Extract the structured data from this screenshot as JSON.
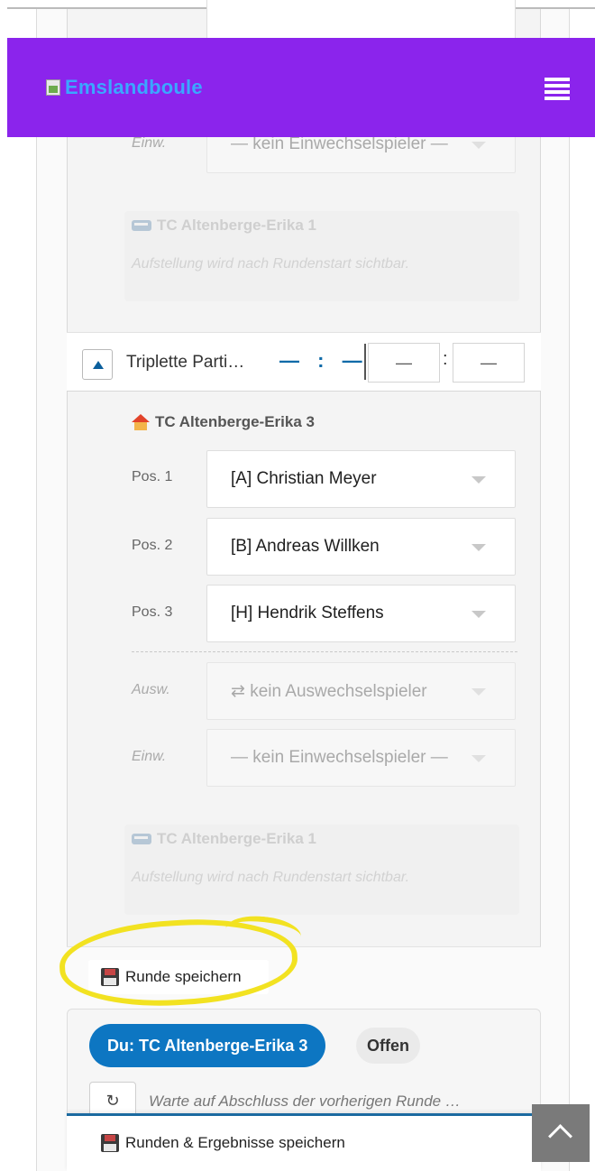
{
  "app": {
    "brand": "Emslandboule"
  },
  "top_partial": {
    "sub_in_label": "Einw.",
    "sub_in_value": "— kein Einwechselspieler —"
  },
  "opponent_top": {
    "name": "TC Altenberge-Erika 1",
    "notice": "Aufstellung wird nach Rundenstart sichtbar."
  },
  "match": {
    "name": "Triplette Parti…",
    "score_left": "—",
    "score_colon": ":",
    "score_right": "—",
    "input_left": "—",
    "input_colon": ":",
    "input_right": "—"
  },
  "team": {
    "name": "TC Altenberge-Erika 3",
    "positions": [
      {
        "label": "Pos. 1",
        "player": "[A] Christian Meyer"
      },
      {
        "label": "Pos. 2",
        "player": "[B] Andreas Willken"
      },
      {
        "label": "Pos. 3",
        "player": "[H] Hendrik Steffens"
      }
    ],
    "sub_out_label": "Ausw.",
    "sub_out_value": "⇄ kein Auswechselspieler",
    "sub_in_label": "Einw.",
    "sub_in_value": "— kein Einwechselspieler —"
  },
  "opponent_bottom": {
    "name": "TC Altenberge-Erika 1",
    "notice": "Aufstellung wird nach Rundenstart sichtbar."
  },
  "save_round_label": "Runde speichern",
  "status": {
    "team_label": "Du: TC Altenberge-Erika 3",
    "state": "Offen",
    "refresh_glyph": "↻",
    "waiting": "Warte auf Abschluss der vorherigen Runde …"
  },
  "bottom": {
    "save_all_label": "Runden & Ergebnisse speichern"
  },
  "colors": {
    "navbar": "#8b24ec",
    "brand_text": "#3ba7ff",
    "primary": "#0d76c2",
    "highlight": "#f2e221"
  },
  "icons": {
    "menu": "hamburger-icon",
    "opponent": "bus-icon",
    "home_team": "house-icon",
    "save": "floppy-disk-icon",
    "refresh": "refresh-icon",
    "scroll_top": "chevron-up-icon"
  }
}
